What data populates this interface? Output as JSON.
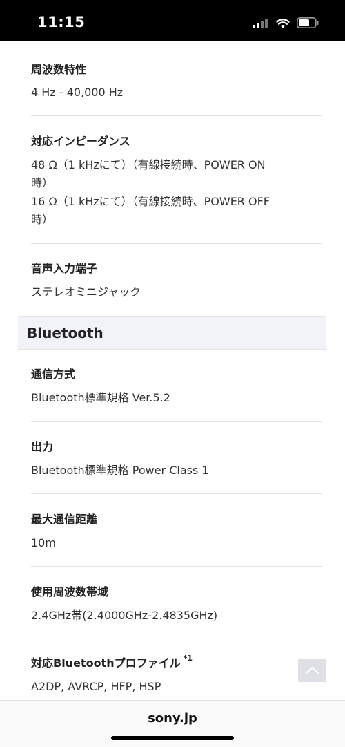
{
  "status_bar": {
    "time": "11:15"
  },
  "specs_top": [
    {
      "label": "周波数特性",
      "values": [
        "4 Hz - 40,000 Hz"
      ]
    },
    {
      "label": "対応インピーダンス",
      "values": [
        "48 Ω（1 kHzにて）（有線接続時、POWER ON",
        "時）",
        "16 Ω（1 kHzにて）（有線接続時、POWER OFF",
        "時）"
      ]
    },
    {
      "label": "音声入力端子",
      "values": [
        "ステレオミニジャック"
      ]
    }
  ],
  "section": {
    "title": "Bluetooth"
  },
  "specs_bluetooth": [
    {
      "label": "通信方式",
      "values": [
        "Bluetooth標準規格 Ver.5.2"
      ]
    },
    {
      "label": "出力",
      "values": [
        "Bluetooth標準規格 Power Class 1"
      ]
    },
    {
      "label": "最大通信距離",
      "values": [
        "10m"
      ]
    },
    {
      "label": "使用周波数帯域",
      "values": [
        "2.4GHz帯(2.4000GHz-2.4835GHz)"
      ]
    },
    {
      "label": "対応Bluetoothプロファイル",
      "note": "*1",
      "values": [
        "A2DP, AVRCP, HFP, HSP"
      ]
    }
  ],
  "bottom_bar": {
    "site": "sony.jp"
  }
}
